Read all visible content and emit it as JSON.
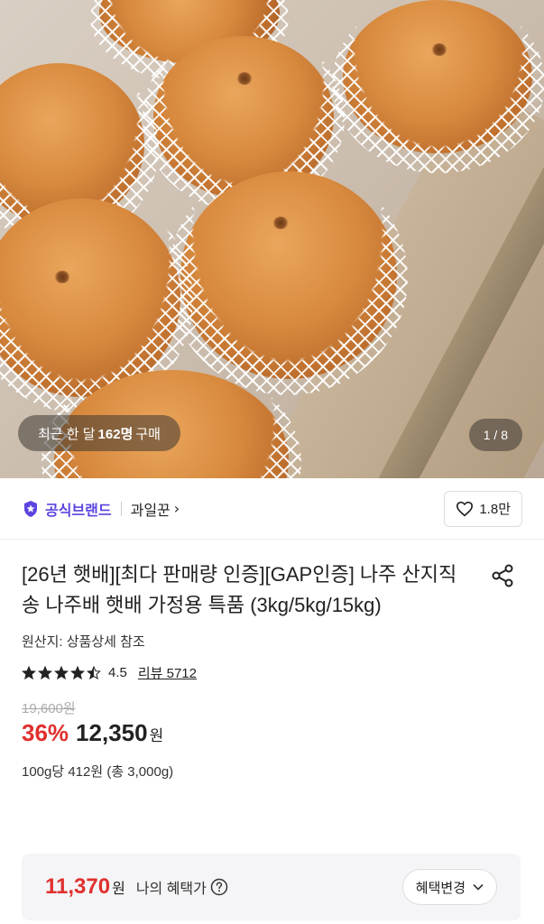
{
  "hero": {
    "purchase_prefix": "최근 한 달",
    "purchase_count": "162명",
    "purchase_suffix": "구매",
    "image_counter": "1 / 8"
  },
  "brand": {
    "official_label": "공식브랜드",
    "store_name": "과일꾼",
    "likes": "1.8만",
    "accent_color": "#5b45e0"
  },
  "product": {
    "title": "[26년 햇배][최다 판매량 인증][GAP인증] 나주 산지직송 나주배 햇배 가정용 특품 (3kg/5kg/15kg)",
    "origin": "원산지: 상품상세 참조",
    "rating": "4.5",
    "rating_value": 4.5,
    "review_label": "리뷰 5712",
    "original_price": "19,600원",
    "discount": "36%",
    "price": "12,350",
    "price_unit": "원",
    "unit_price": "100g당 412원 (총 3,000g)",
    "discount_color": "#e0302e"
  },
  "benefit": {
    "price": "11,370",
    "price_unit": "원",
    "label": "나의 혜택가",
    "change_label": "혜택변경"
  }
}
